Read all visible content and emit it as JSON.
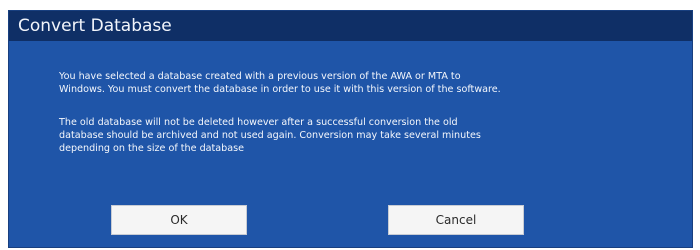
{
  "dialog": {
    "title": "Convert Database",
    "message_1_line_1": "You have selected a database created with a previous version of the AWA or MTA to",
    "message_1_line_2": "Windows. You must convert the database in order to use it with this version of the software.",
    "message_2_line_1": "The old database will not be deleted however after a successful conversion the old",
    "message_2_line_2": "database should be archived and not used again.  Conversion may take several minutes",
    "message_2_line_3": "depending on the size of the database",
    "ok_label": "OK",
    "cancel_label": "Cancel"
  },
  "colors": {
    "dialog_body": "#1f55a8",
    "title_bar": "#0f2f66",
    "text": "#f4f7fc",
    "button_face": "#f5f5f5"
  }
}
